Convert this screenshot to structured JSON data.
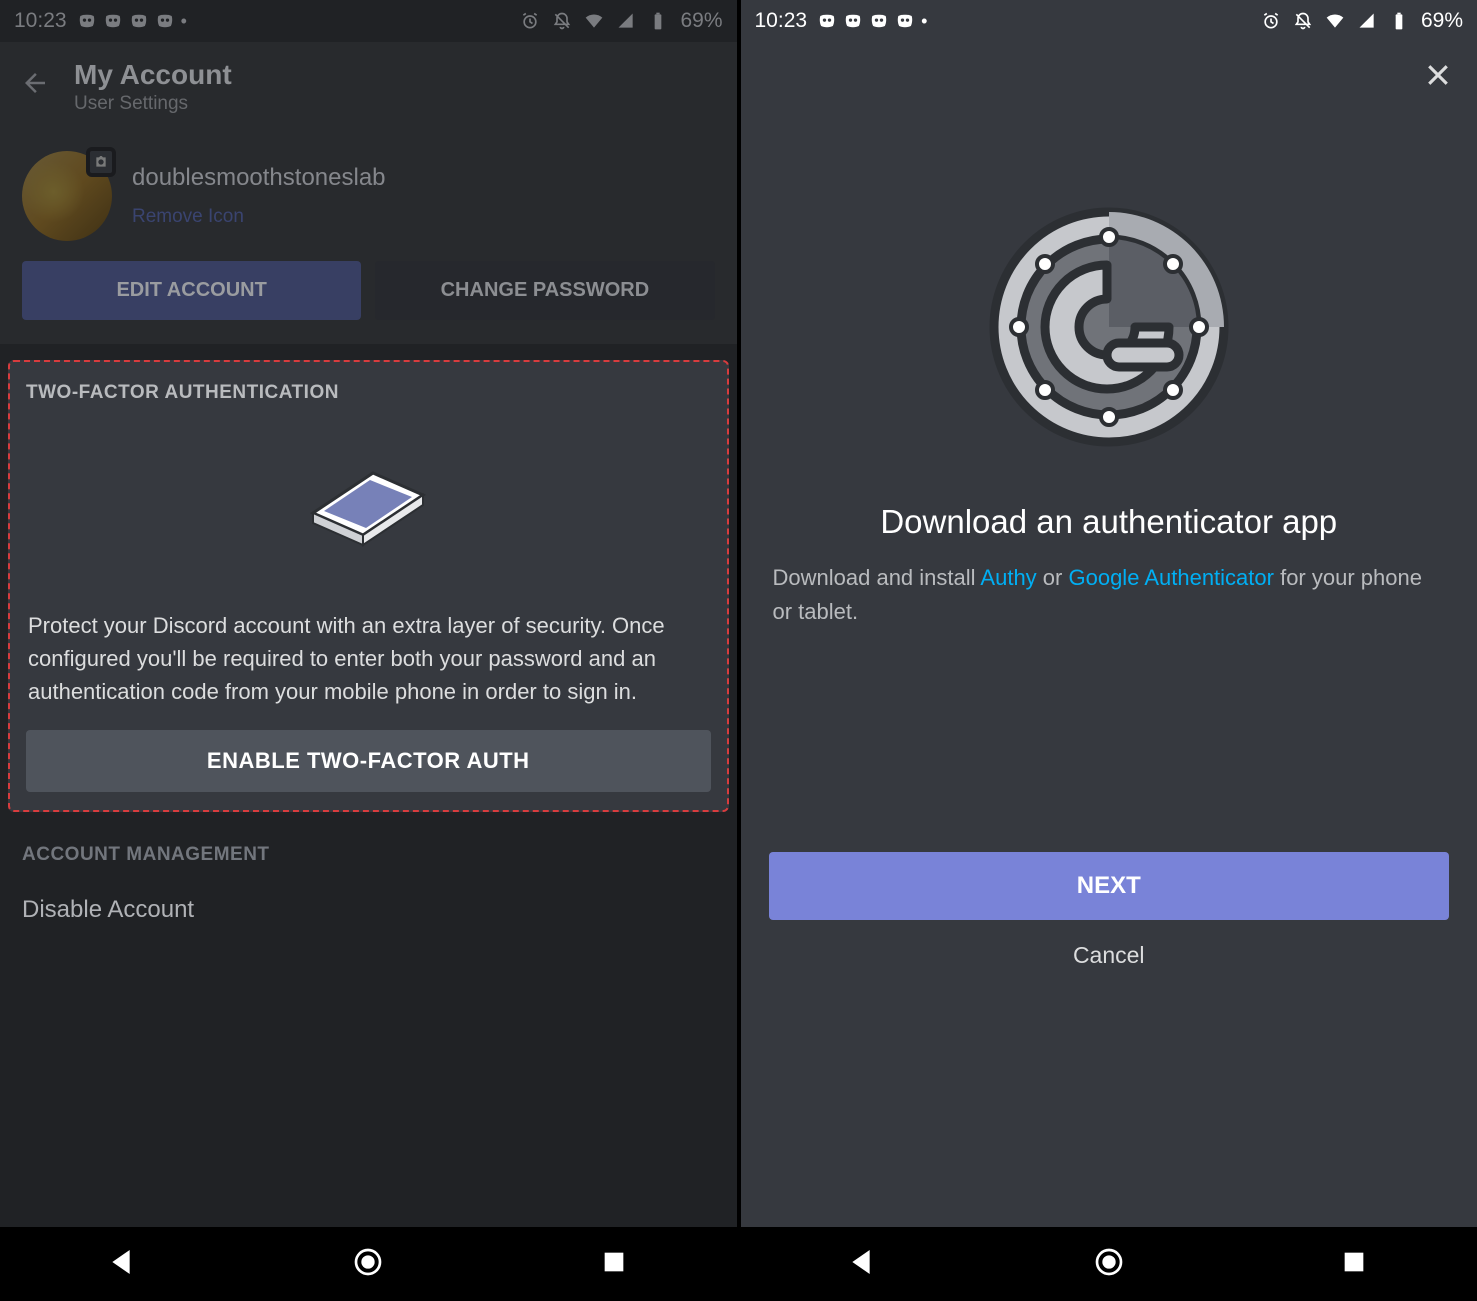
{
  "status": {
    "time": "10:23",
    "battery": "69%"
  },
  "left": {
    "header": {
      "title": "My Account",
      "subtitle": "User Settings"
    },
    "profile": {
      "username": "doublesmoothstoneslab",
      "remove_label": "Remove Icon"
    },
    "buttons": {
      "edit": "EDIT ACCOUNT",
      "change_pw": "CHANGE PASSWORD"
    },
    "tfa": {
      "heading": "TWO-FACTOR AUTHENTICATION",
      "description": "Protect your Discord account with an extra layer of security. Once configured you'll be required to enter both your password and an authentication code from your mobile phone in order to sign in.",
      "enable_label": "ENABLE TWO-FACTOR AUTH"
    },
    "mgmt": {
      "heading": "ACCOUNT MANAGEMENT",
      "disable": "Disable Account"
    }
  },
  "right": {
    "title": "Download an authenticator app",
    "desc_pre": "Download and install ",
    "link1": "Authy",
    "desc_mid": " or ",
    "link2": "Google Authenticator",
    "desc_post": " for your phone or tablet.",
    "next": "NEXT",
    "cancel": "Cancel"
  }
}
